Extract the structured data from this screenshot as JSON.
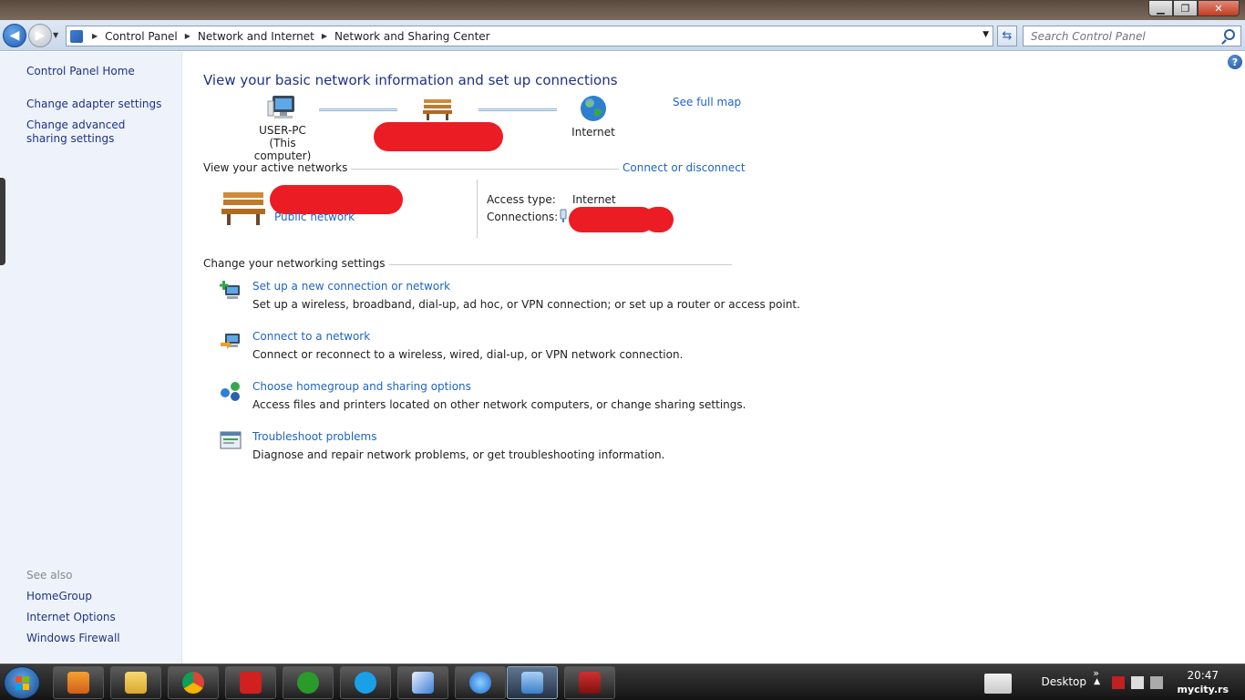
{
  "window": {
    "minimize": "▁",
    "maximize": "❐",
    "close": "✕"
  },
  "address_bar": {
    "breadcrumbs": [
      "Control Panel",
      "Network and Internet",
      "Network and Sharing Center"
    ],
    "search_placeholder": "Search Control Panel"
  },
  "left_pane": {
    "home": "Control Panel Home",
    "links": [
      "Change adapter settings",
      "Change advanced sharing settings"
    ],
    "see_also_label": "See also",
    "see_also": [
      "HomeGroup",
      "Internet Options",
      "Windows Firewall"
    ]
  },
  "main": {
    "title": "View your basic network information and set up connections",
    "see_full_map": "See full map",
    "map": {
      "computer_name": "USER-PC",
      "computer_sub": "(This computer)",
      "internet": "Internet"
    },
    "active_networks_label": "View your active networks",
    "connect_disconnect": "Connect or disconnect",
    "network_type": "Public network",
    "access_type_label": "Access type:",
    "access_type_value": "Internet",
    "connections_label": "Connections:",
    "change_settings_label": "Change your networking settings",
    "tasks": [
      {
        "title": "Set up a new connection or network",
        "desc": "Set up a wireless, broadband, dial-up, ad hoc, or VPN connection; or set up a router or access point.",
        "icon": "new-connection-icon"
      },
      {
        "title": "Connect to a network",
        "desc": "Connect or reconnect to a wireless, wired, dial-up, or VPN network connection.",
        "icon": "connect-network-icon"
      },
      {
        "title": "Choose homegroup and sharing options",
        "desc": "Access files and printers located on other network computers, or change sharing settings.",
        "icon": "homegroup-icon"
      },
      {
        "title": "Troubleshoot problems",
        "desc": "Diagnose and repair network problems, or get troubleshooting information.",
        "icon": "troubleshoot-icon"
      }
    ]
  },
  "taskbar": {
    "desktop_label": "Desktop",
    "time": "20:47",
    "watermark": "mycity.rs",
    "apps": [
      "media-player-icon",
      "explorer-icon",
      "chrome-icon",
      "acrobat-icon",
      "utorrent-icon",
      "skype-icon",
      "notepad-icon",
      "ie-icon",
      "control-panel-icon",
      "book-icon"
    ]
  },
  "colors": {
    "link": "#1e64c8",
    "title": "#1e3287",
    "left_pane_bg": "#eef3fb",
    "redaction": "#ec1c24"
  }
}
